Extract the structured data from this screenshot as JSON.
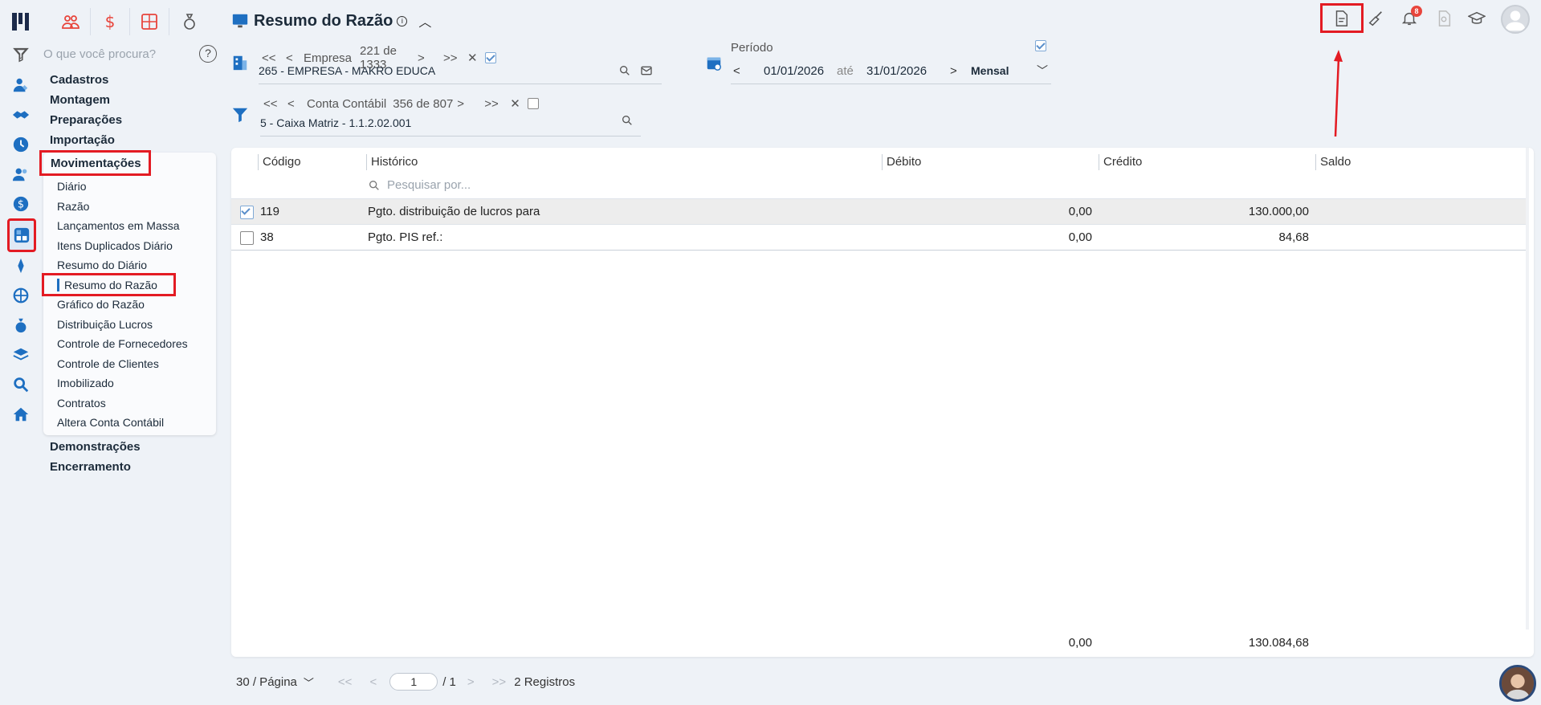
{
  "sidebar": {
    "search_placeholder": "O que você procura?",
    "help": "?",
    "menu": [
      "Cadastros",
      "Montagem",
      "Preparações",
      "Importação",
      "Movimentações",
      "Demonstrações",
      "Encerramento"
    ],
    "sub": [
      "Diário",
      "Razão",
      "Lançamentos em Massa",
      "Itens Duplicados Diário",
      "Resumo do Diário",
      "Resumo do Razão",
      "Gráfico do Razão",
      "Distribuição Lucros",
      "Controle de Fornecedores",
      "Controle de Clientes",
      "Imobilizado",
      "Contratos",
      "Altera Conta Contábil"
    ]
  },
  "header": {
    "title": "Resumo do Razão",
    "info": "i"
  },
  "empresa": {
    "label": "Empresa",
    "counter": "221 de 1333",
    "value": "265 - EMPRESA - MAKRO EDUCA"
  },
  "conta": {
    "label": "Conta Contábil",
    "counter": "356 de 807",
    "value": "5 - Caixa Matriz  - 1.1.2.02.001"
  },
  "periodo": {
    "label": "Período",
    "from": "01/01/2026",
    "ate": "até",
    "to": "31/01/2026",
    "mode": "Mensal"
  },
  "notifications": {
    "count": "8"
  },
  "table": {
    "headers": [
      "Código",
      "Histórico",
      "Débito",
      "Crédito",
      "Saldo"
    ],
    "search_placeholder": "Pesquisar por...",
    "rows": [
      {
        "codigo": "119",
        "historico": "Pgto. distribuição de lucros para",
        "debito": "0,00",
        "credito": "130.000,00",
        "saldo": "",
        "checked": true
      },
      {
        "codigo": "38",
        "historico": "Pgto. PIS ref.:",
        "debito": "0,00",
        "credito": "84,68",
        "saldo": "",
        "checked": false
      }
    ],
    "total_debito": "0,00",
    "total_credito": "130.084,68"
  },
  "footer": {
    "per_page": "30 / Página",
    "first": "<<",
    "prev": "<",
    "page": "1",
    "of": "/ 1",
    "next": ">",
    "last": ">>",
    "records": "2 Registros"
  },
  "colors": {
    "accent": "#1e6fc1",
    "highlight": "#e31b23"
  }
}
